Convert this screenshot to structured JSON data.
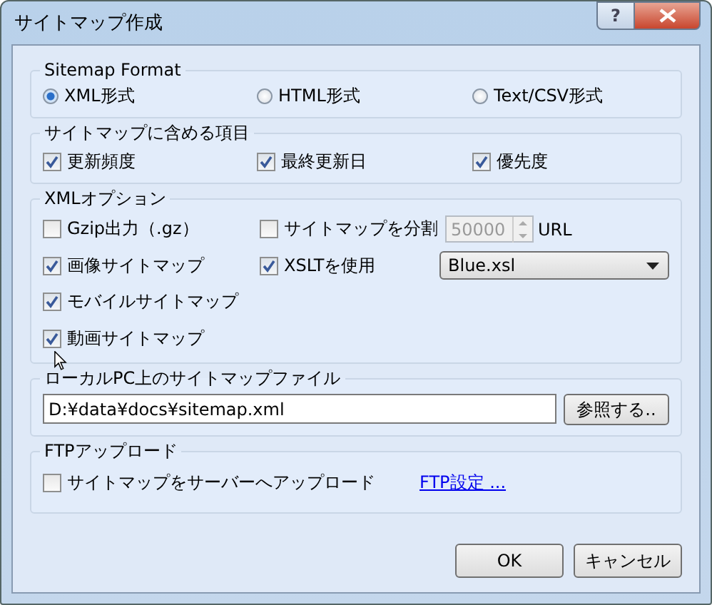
{
  "window": {
    "title": "サイトマップ作成",
    "help_button": "?"
  },
  "sitemap_format": {
    "legend": "Sitemap Format",
    "options": [
      {
        "label": "XML形式",
        "selected": true
      },
      {
        "label": "HTML形式",
        "selected": false
      },
      {
        "label": "Text/CSV形式",
        "selected": false
      }
    ]
  },
  "included_items": {
    "legend": "サイトマップに含める項目",
    "items": [
      {
        "label": "更新頻度",
        "checked": true
      },
      {
        "label": "最終更新日",
        "checked": true
      },
      {
        "label": "優先度",
        "checked": true
      }
    ]
  },
  "xml_options": {
    "legend": "XMLオプション",
    "items": [
      {
        "label": "Gzip出力（.gz）",
        "checked": false
      },
      {
        "label": "画像サイトマップ",
        "checked": true
      },
      {
        "label": "モバイルサイトマップ",
        "checked": true
      },
      {
        "label": "動画サイトマップ",
        "checked": true
      }
    ],
    "split": {
      "label": "サイトマップを分割",
      "checked": false,
      "value": "50000",
      "disabled": true,
      "unit": "URL"
    },
    "xslt": {
      "label": "XSLTを使用",
      "checked": true,
      "value": "Blue.xsl"
    }
  },
  "local_file": {
    "legend": "ローカルPC上のサイトマップファイル",
    "path": "D:¥data¥docs¥sitemap.xml",
    "browse_button": "参照する.."
  },
  "ftp": {
    "legend": "FTPアップロード",
    "upload": {
      "label": "サイトマップをサーバーへアップロード",
      "checked": false
    },
    "link": "FTP設定 ..."
  },
  "buttons": [
    "OK",
    "キャンセル"
  ]
}
